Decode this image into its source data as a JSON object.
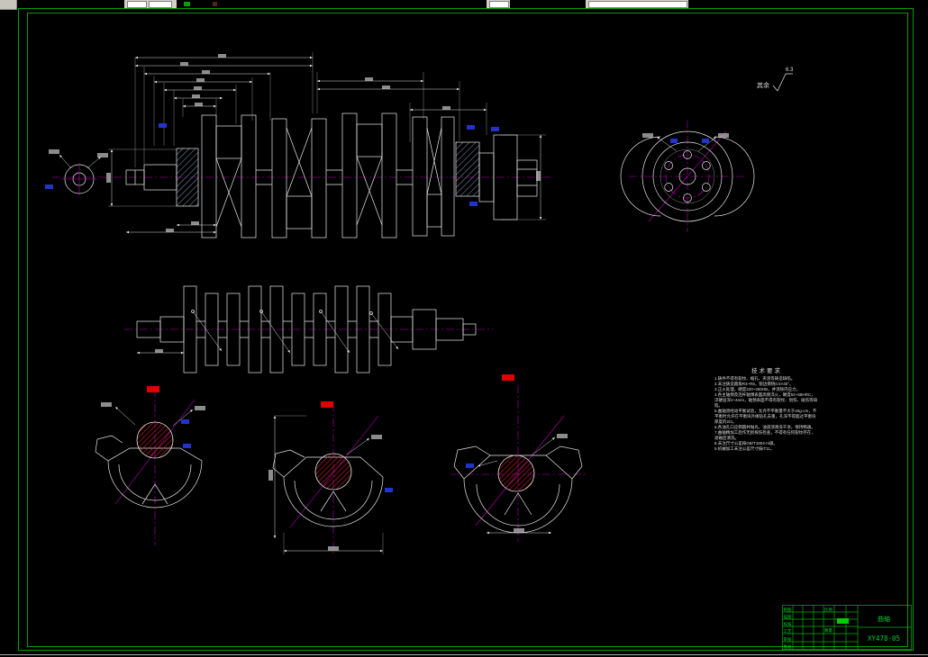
{
  "colors": {
    "background": "#000000",
    "frame_green": "#00a000",
    "line_white": "#e8e8e8",
    "centerline_magenta": "#b400b4",
    "hatch_blue": "#8fb0c8",
    "hatch_red": "#d42020",
    "marker_red": "#e00000",
    "marker_blue": "#2233cc",
    "titleblock_green": "#00cc33",
    "toolbar_gray": "#d4d0c8"
  },
  "surface_note": {
    "label": "其余",
    "value": "6.3"
  },
  "tech_notes": {
    "title": "技术要求",
    "lines": [
      "1.铸件不得有裂纹、缩孔、夹渣等铸造缺陷。",
      "2.未注铸造圆角R3~R5，锐边倒钝0.5×45°。",
      "3.正火处理，硬度220~250HB，并消除内应力。",
      "4.各主轴颈及连杆轴颈表面高频淬火，硬度52~58HRC，淬硬层深2~4mm，轴颈表面不得有裂纹、划伤、碰伤等缺陷。",
      "5.曲轴须经动平衡试验，允许不平衡量不大于40g·cm，不平衡时允许在平衡块外缘钻孔去重，孔深不得超过平衡块厚度的2/3。",
      "6.各油孔口应倒圆并抛光，油道须清洗干净，保持畅通。",
      "7.曲轴精加工后作无损探伤检查，不得有任何裂纹存在，退磁后清洗。",
      "8.未注尺寸公差按GB/T1804-m级。",
      "9.机械加工未注公差尺寸按IT11。"
    ]
  },
  "title_block": {
    "drawing_number": "XY478-05",
    "part_name": "曲轴",
    "row_labels": [
      "制图",
      "描图",
      "校核",
      "工艺",
      "审核",
      "批准"
    ],
    "col_labels": [
      "比例",
      "数量"
    ]
  }
}
